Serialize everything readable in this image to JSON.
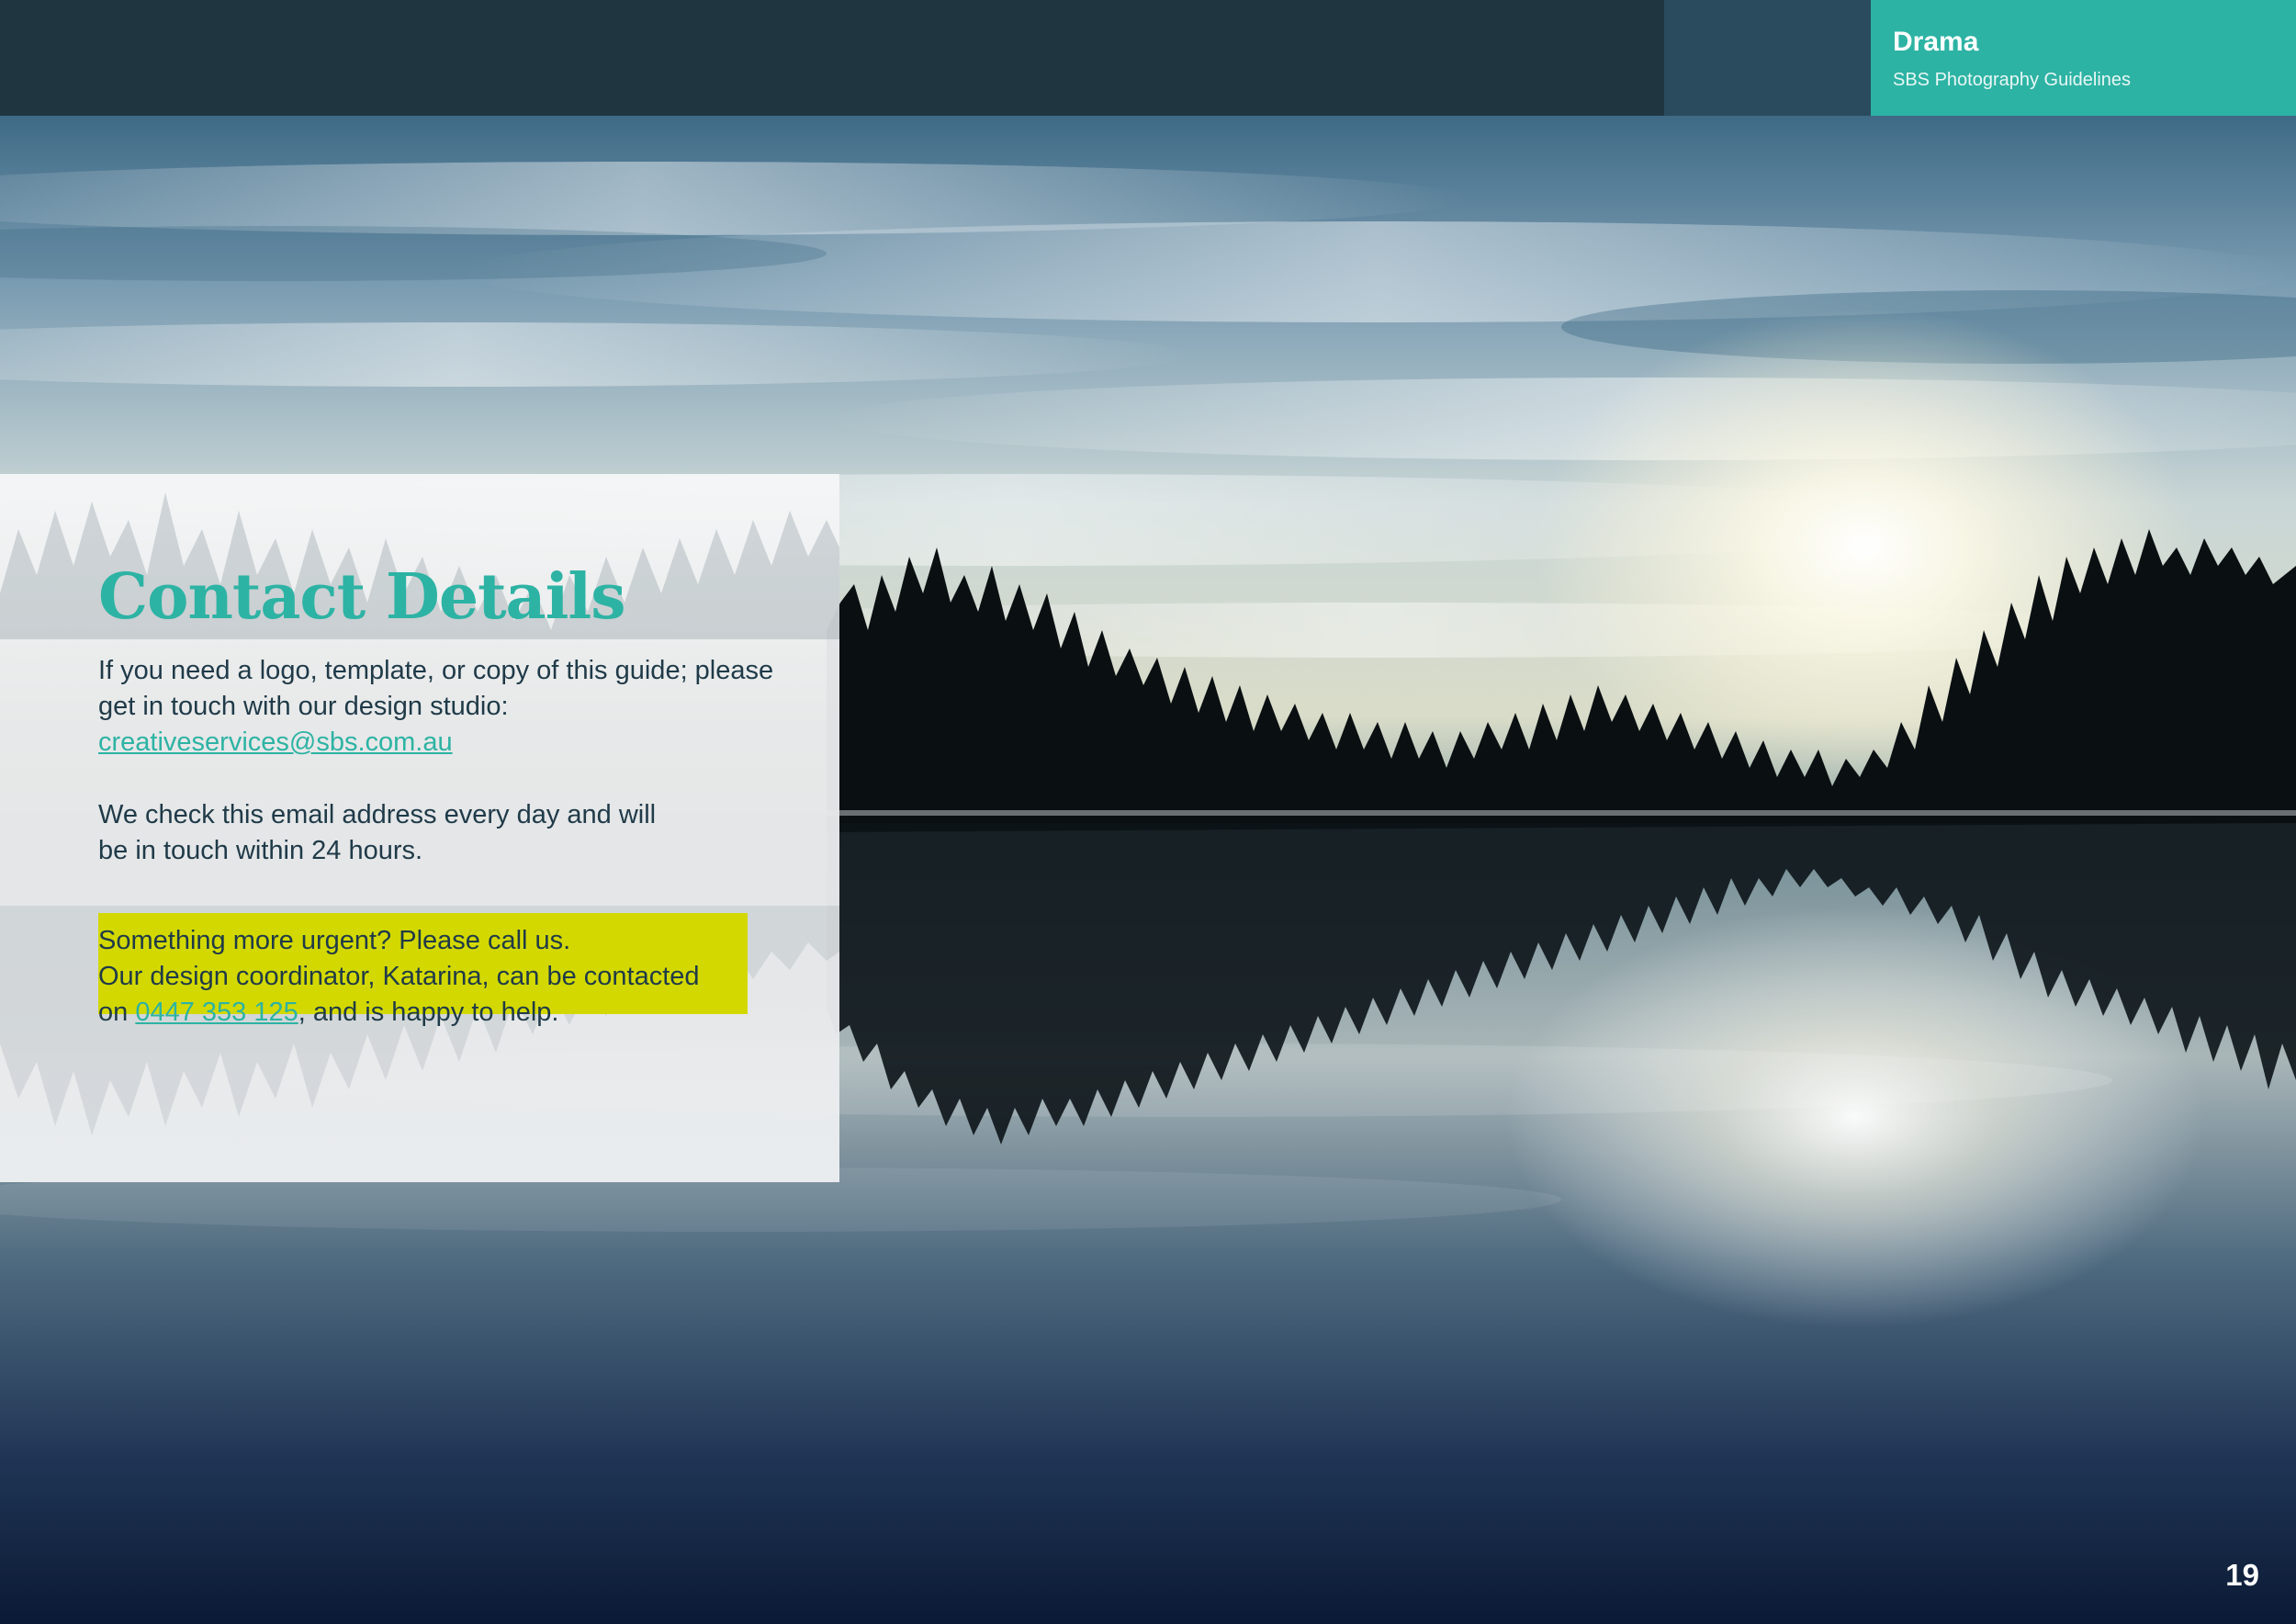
{
  "header": {
    "section_title": "Drama",
    "document_title": "SBS Photography Guidelines"
  },
  "contact": {
    "heading": "Contact Details",
    "intro_line1": "If you need a logo, template, or copy of this guide; please",
    "intro_line2": "get in touch with our design studio:",
    "email": "creativeservices@sbs.com.au",
    "check_line1": "We check this email address every day and will",
    "check_line2": "be in touch within 24 hours.",
    "urgent_line1": "Something more urgent? Please call us.",
    "urgent_line2": "Our design coordinator, Katarina, can be contacted",
    "urgent_prefix": "on ",
    "phone": "0447 353 125",
    "urgent_suffix": ", and is happy to help."
  },
  "page_number": "19",
  "colors": {
    "brand_teal": "#2db3a4",
    "header_dark": "#1f3540",
    "highlight_yellow": "#d3d900"
  }
}
